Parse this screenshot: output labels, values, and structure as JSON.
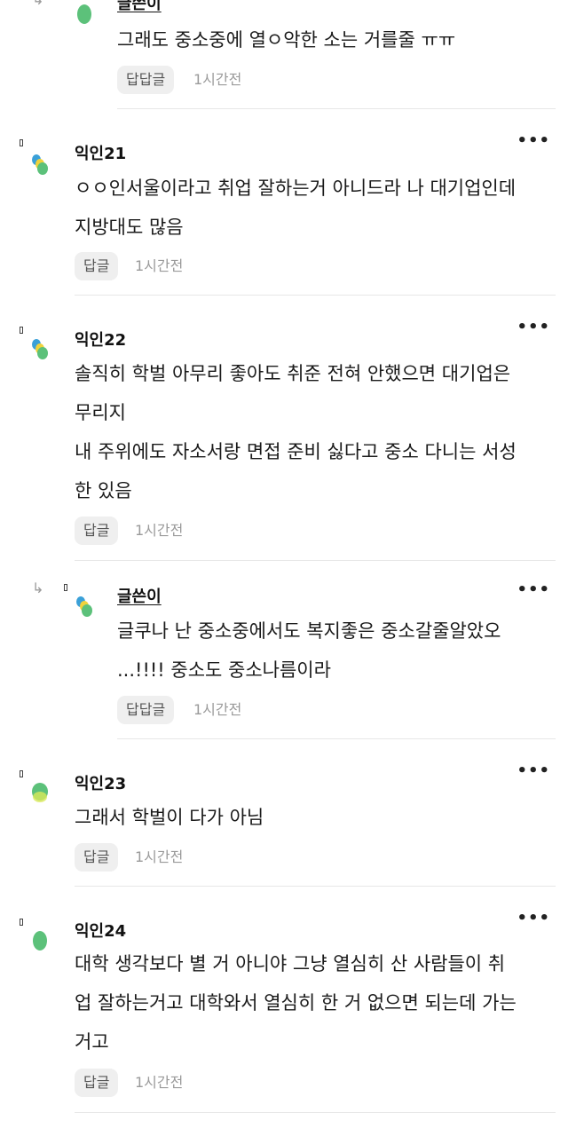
{
  "colors": {
    "divider": "#e7e7e7",
    "reply_bg": "#efefef",
    "muted": "#9a9a9a"
  },
  "comments": [
    {
      "author": "글쓴이",
      "is_reply": true,
      "lines": [
        "그래도 중소중에 열ㅇ악한 소는 거를줄 ㅠㅠ"
      ],
      "reply_label": "답답글",
      "time": "1시간전"
    },
    {
      "author": "익인21",
      "is_reply": false,
      "lines": [
        "ㅇㅇ인서울이라고 취업 잘하는거 아니드라 나 대기업인데",
        "지방대도 많음"
      ],
      "reply_label": "답글",
      "time": "1시간전"
    },
    {
      "author": "익인22",
      "is_reply": false,
      "lines": [
        "솔직히 학벌 아무리 좋아도 취준 전혀 안했으면 대기업은",
        "무리지",
        "내 주위에도 자소서랑 면접 준비 싫다고 중소 다니는 서성",
        "한 있음"
      ],
      "reply_label": "답글",
      "time": "1시간전"
    },
    {
      "author": "글쓴이",
      "is_reply": true,
      "lines": [
        "글쿠나 난 중소중에서도 복지좋은 중소갈줄알았오",
        "...!!!! 중소도 중소나름이라"
      ],
      "reply_label": "답답글",
      "time": "1시간전"
    },
    {
      "author": "익인23",
      "is_reply": false,
      "lines": [
        "그래서 학벌이 다가 아님"
      ],
      "reply_label": "답글",
      "time": "1시간전"
    },
    {
      "author": "익인24",
      "is_reply": false,
      "lines": [
        "대학 생각보다 별 거 아니야 그냥 열심히 산 사람들이 취",
        "업 잘하는거고 대학와서 열심히 한 거 없으면 되는데 가는",
        "거고"
      ],
      "reply_label": "답글",
      "time": "1시간전"
    }
  ]
}
